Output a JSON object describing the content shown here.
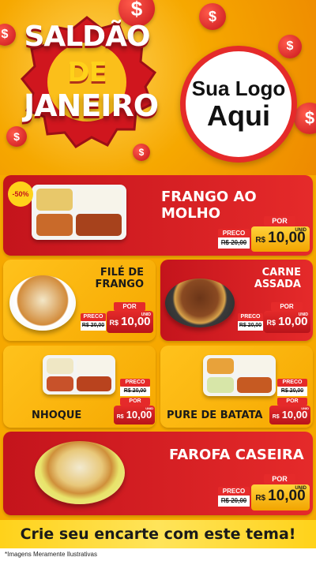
{
  "header": {
    "title_line1": "SALDÃO",
    "title_line2": "DE",
    "title_line3": "JANEIRO",
    "logo_line1": "Sua Logo",
    "logo_line2": "Aqui",
    "coin_symbol": "$"
  },
  "products": [
    {
      "name": "FRANGO AO MOLHO",
      "badge": "-50%",
      "preco_label": "PRECO",
      "old_price": "R$ 20,00",
      "por_label": "POR",
      "currency": "R$",
      "new_price": "10,00",
      "unit": "UNID"
    },
    {
      "name_line1": "FILÉ DE",
      "name_line2": "FRANGO",
      "preco_label": "PRECO",
      "old_price": "R$ 20,00",
      "por_label": "POR",
      "currency": "R$",
      "new_price": "10,00",
      "unit": "UNID"
    },
    {
      "name_line1": "CARNE",
      "name_line2": "ASSADA",
      "preco_label": "PRECO",
      "old_price": "R$ 20,00",
      "por_label": "POR",
      "currency": "R$",
      "new_price": "10,00",
      "unit": "UNID"
    },
    {
      "name": "NHOQUE",
      "preco_label": "PRECO",
      "old_price": "R$ 20,00",
      "por_label": "POR",
      "currency": "R$",
      "new_price": "10,00",
      "unit": "UNID"
    },
    {
      "name": "PURE DE BATATA",
      "preco_label": "PRECO",
      "old_price": "R$ 20,00",
      "por_label": "POR",
      "currency": "R$",
      "new_price": "10,00",
      "unit": "UNID"
    },
    {
      "name": "FAROFA CASEIRA",
      "preco_label": "PRECO",
      "old_price": "R$ 20,00",
      "por_label": "POR",
      "currency": "R$",
      "new_price": "10,00",
      "unit": "UNID"
    }
  ],
  "cta": "Crie seu encarte com este tema!",
  "footer_note": "*Imagens Meramente Ilustrativas",
  "colors": {
    "red": "#e52a2a",
    "dark_red": "#c4141c",
    "yellow": "#ffd21a",
    "orange": "#f6a800"
  }
}
